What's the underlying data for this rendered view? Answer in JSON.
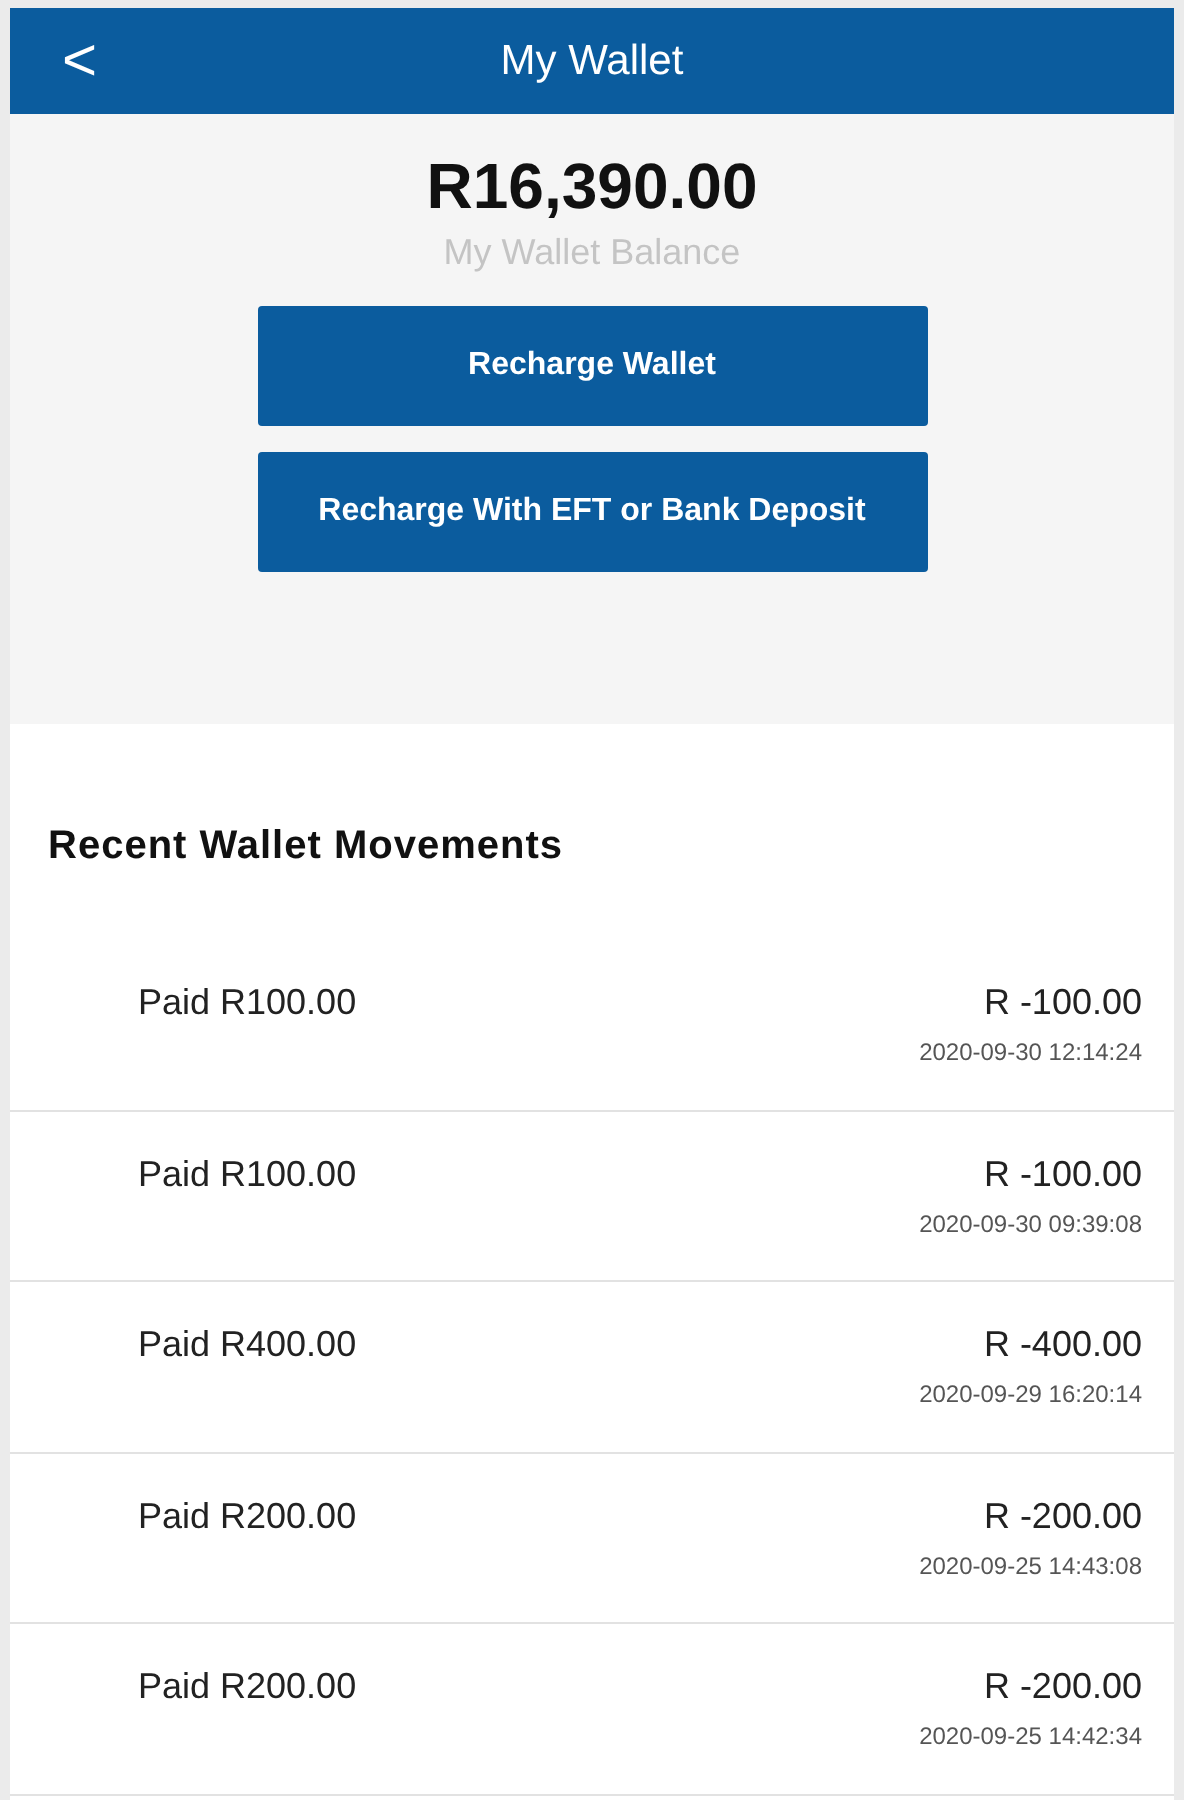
{
  "header": {
    "back": "<",
    "title": "My Wallet"
  },
  "balance": {
    "amount": "R16,390.00",
    "label": "My Wallet Balance"
  },
  "buttons": [
    "Recharge Wallet",
    "Recharge With EFT or Bank Deposit"
  ],
  "movements": {
    "title": "Recent Wallet Movements",
    "items": [
      {
        "description": "Paid R100.00",
        "amount": "R -100.00",
        "timestamp": "2020-09-30 12:14:24"
      },
      {
        "description": "Paid R100.00",
        "amount": "R -100.00",
        "timestamp": "2020-09-30 09:39:08"
      },
      {
        "description": "Paid R400.00",
        "amount": "R -400.00",
        "timestamp": "2020-09-29 16:20:14"
      },
      {
        "description": "Paid R200.00",
        "amount": "R -200.00",
        "timestamp": "2020-09-25 14:43:08"
      },
      {
        "description": "Paid R200.00",
        "amount": "R -200.00",
        "timestamp": "2020-09-25 14:42:34"
      }
    ]
  }
}
